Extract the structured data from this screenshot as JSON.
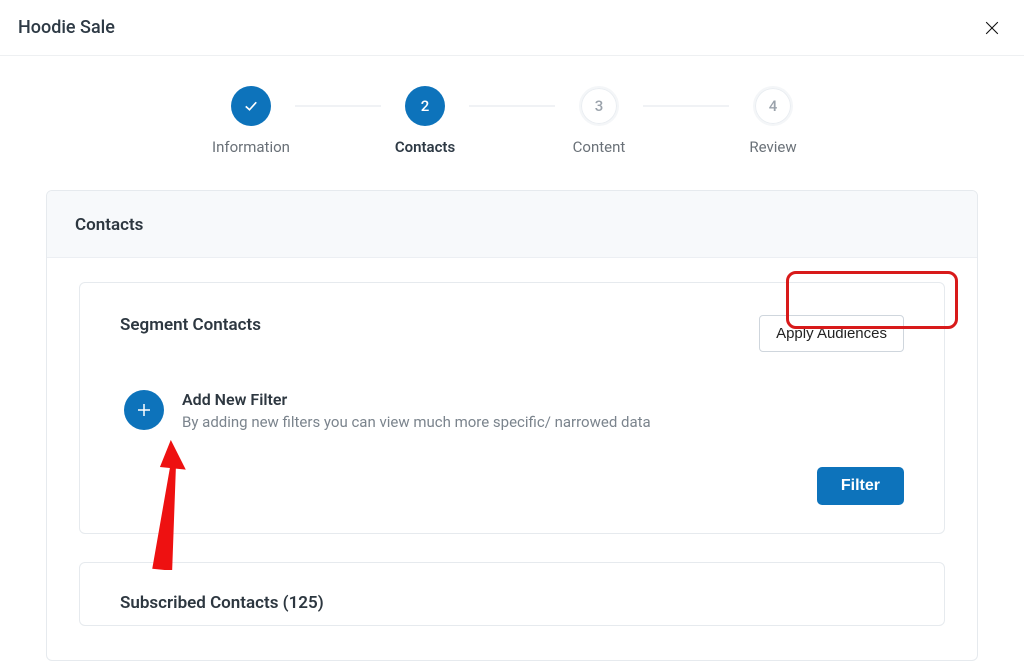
{
  "header": {
    "title": "Hoodie Sale"
  },
  "stepper": {
    "steps": [
      {
        "label": "Information",
        "state": "done",
        "display": "check"
      },
      {
        "label": "Contacts",
        "state": "active",
        "display": "2"
      },
      {
        "label": "Content",
        "state": "pending",
        "display": "3"
      },
      {
        "label": "Review",
        "state": "pending",
        "display": "4"
      }
    ]
  },
  "panel": {
    "header": "Contacts"
  },
  "segment": {
    "title": "Segment Contacts",
    "apply_button": "Apply Audiences",
    "add_filter": {
      "title": "Add New Filter",
      "description": "By adding new filters you can view much more specific/ narrowed data"
    },
    "filter_button": "Filter"
  },
  "subscribed": {
    "title": "Subscribed Contacts (125)"
  }
}
